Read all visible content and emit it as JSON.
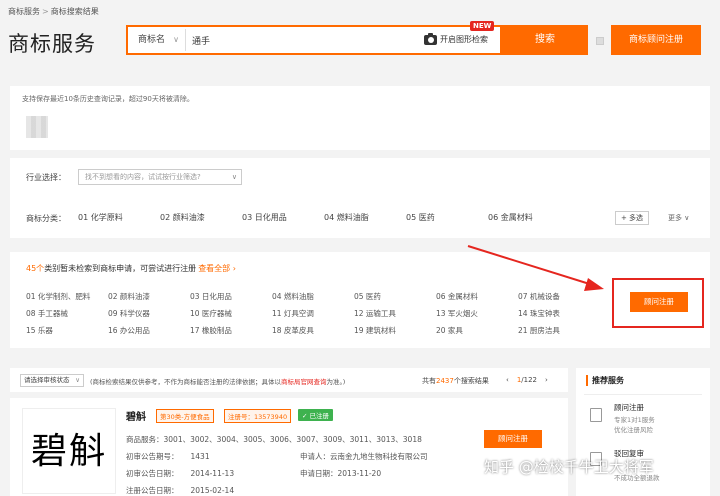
{
  "breadcrumb": [
    "商标服务",
    "商标搜索结果"
  ],
  "page_title": "商标服务",
  "search": {
    "type_label": "商标名",
    "query": "通手",
    "image_search_label": "开启图形检索",
    "new_badge": "NEW",
    "search_button": "搜索",
    "consult_button": "商标顾问注册"
  },
  "history": {
    "note": "支持保存最近10条历史查询记录，超过90天将被清除。"
  },
  "filters": {
    "industry_label": "行业选择：",
    "industry_placeholder": "找不到想看的内容，试试按行业筛选?",
    "category_label": "商标分类：",
    "categories": [
      "01 化学原料",
      "02 颜料油漆",
      "03 日化用品",
      "04 燃料油脂",
      "05 医药",
      "06 金属材料"
    ],
    "multi_select": "+ 多选",
    "more": "更多 ∨"
  },
  "suggest": {
    "count": "45个",
    "text": "类别暂未检索到商标申请，可尝试进行注册",
    "link": "查看全部 ›",
    "items": [
      "01 化学制剂、肥料",
      "02 颜料油漆",
      "03 日化用品",
      "04 燃料油脂",
      "05 医药",
      "06 金属材料",
      "07 机械设备",
      "08 手工器械",
      "09 科学仪器",
      "10 医疗器械",
      "11 灯具空调",
      "12 运输工具",
      "13 军火烟火",
      "14 珠宝钟表",
      "15 乐器",
      "16 办公用品",
      "17 橡胶制品",
      "18 皮革皮具",
      "19 建筑材料",
      "20 家具",
      "21 厨房洁具"
    ],
    "button": "顾问注册"
  },
  "results": {
    "status_select": "请选择审核状态",
    "note_prefix": "(商标检索结果仅供参考，不作为商标能否注册的法律依据；具体以",
    "note_link": "商标局官网查询",
    "note_suffix": "为准。)",
    "count_prefix": "共有",
    "count": "2437",
    "count_suffix": "个搜索结果",
    "page_current": "1",
    "page_total": "/122",
    "prev": "‹",
    "next": "›"
  },
  "result_card": {
    "image_text": "碧斛",
    "name": "碧斛",
    "class_tag": "第30类-方便食品",
    "reg_tag": "注册号：13573940",
    "status_tag": "✓ 已注册",
    "services_label": "商品服务：",
    "services": "3001、3002、3004、3005、3006、3007、3009、3011、3013、3018",
    "prelim_no_label": "初审公告期号：",
    "prelim_no": "1431",
    "applicant_label": "申请人：",
    "applicant": "云南金九地生物科技有限公司",
    "prelim_date_label": "初审公告日期：",
    "prelim_date": "2014-11-13",
    "apply_date_label": "申请日期：",
    "apply_date": "2013-11-20",
    "reg_date_label": "注册公告日期：",
    "reg_date": "2015-02-14",
    "button": "顾问注册"
  },
  "recommend": {
    "title": "推荐服务",
    "items": [
      {
        "name": "顾问注册",
        "desc1": "专家1对1服务",
        "desc2": "优化注册风险"
      },
      {
        "name": "驳回复审",
        "desc1": "",
        "desc2": "不成功全额退款"
      }
    ]
  },
  "watermark": "知乎 @检校千牛卫大将军",
  "colors": {
    "accent": "#ff6a00",
    "alert": "#e5261f",
    "success": "#3eb24f"
  }
}
